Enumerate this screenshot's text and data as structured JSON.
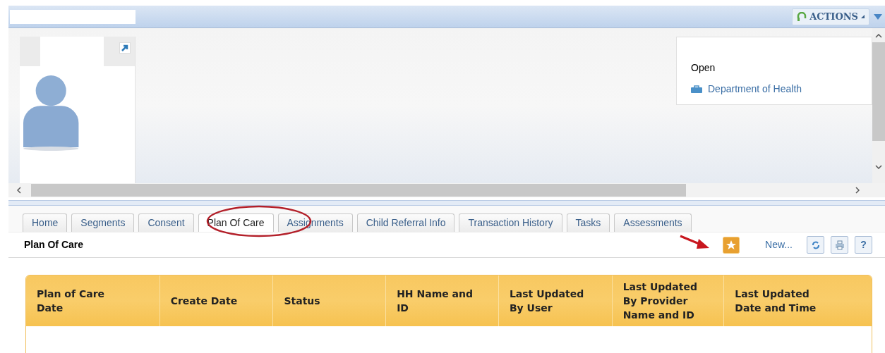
{
  "header": {
    "actions_button": "ACTIONS",
    "status": "Open",
    "department_link": "Department of Health"
  },
  "tabs": [
    {
      "label": "Home",
      "selected": false
    },
    {
      "label": "Segments",
      "selected": false
    },
    {
      "label": "Consent",
      "selected": false
    },
    {
      "label": "Plan Of Care",
      "selected": true
    },
    {
      "label": "Assignments",
      "selected": false
    },
    {
      "label": "Child Referral Info",
      "selected": false
    },
    {
      "label": "Transaction History",
      "selected": false
    },
    {
      "label": "Tasks",
      "selected": false
    },
    {
      "label": "Assessments",
      "selected": false
    }
  ],
  "panel": {
    "title": "Plan Of Care",
    "new_button": "New...",
    "help_button": "?"
  },
  "table": {
    "columns": [
      "Plan of Care Date",
      "Create Date",
      "Status",
      "HH Name and ID",
      "Last Updated By User",
      "Last Updated By Provider Name and ID",
      "Last Updated Date and Time"
    ]
  }
}
